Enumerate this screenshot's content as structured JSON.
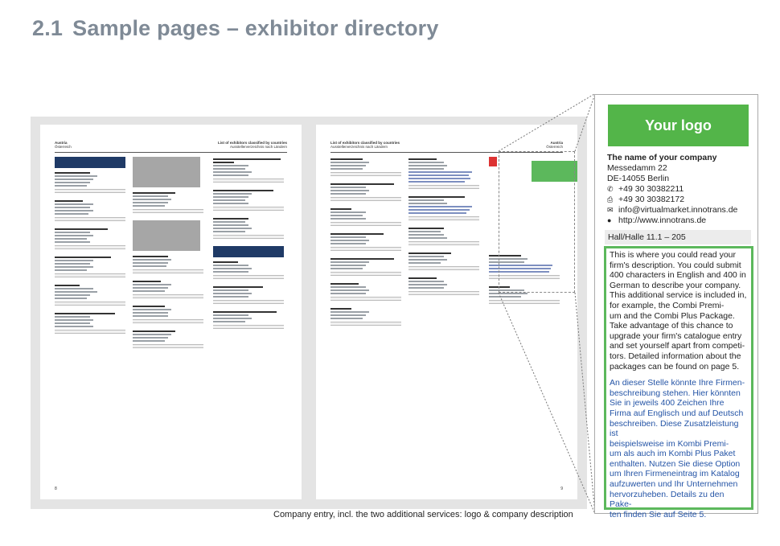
{
  "heading": {
    "number": "2.1",
    "title": "Sample pages – exhibitor directory"
  },
  "spread": {
    "left_page": {
      "title": "Austria",
      "subtitle": "Österreich",
      "right_title": "List of exhibitors classified by countries",
      "right_subtitle": "Ausstellerverzeichnis nach Ländern",
      "page_number": "8"
    },
    "right_page": {
      "title": "List of exhibitors classified by countries",
      "subtitle": "Ausstellerverzeichnis nach Ländern",
      "right_title": "Austria",
      "right_subtitle": "Österreich",
      "page_number": "9"
    }
  },
  "caption": "Company entry, incl. the two additional services: logo & company description",
  "card": {
    "logo_text": "Your logo",
    "company_name": "The name of your company",
    "street": "Messedamm 22",
    "city": "DE-14055 Berlin",
    "phone": "+49 30 30382211",
    "fax": "+49 30 30382172",
    "email": "info@virtualmarket.innotrans.de",
    "web": "http://www.innotrans.de",
    "hall": "Hall/Halle 11.1 – 205",
    "description_en": "This is where you could read your\nfirm's description. You could submit\n400 characters in English and 400 in\nGerman to describe your company.\nThis additional service is included in,\nfor example, the Combi Premi-\num and the Combi Plus Package.\nTake advantage of this chance to\nupgrade your firm's catalogue entry\nand set yourself apart from competi-\ntors. Detailed information about the\npackages can be found on page 5.",
    "description_de": "An dieser Stelle könnte Ihre Firmen-\nbeschreibung stehen. Hier könnten\nSie in jeweils 400 Zeichen Ihre\nFirma auf Englisch und auf Deutsch\nbeschreiben. Diese Zusatzleistung ist\nbeispielsweise im Kombi Premi-\num als auch im Kombi Plus Paket\nenthalten. Nutzen Sie diese Option\num Ihren Firmeneintrag im Katalog\naufzuwerten und Ihr Unternehmen\nhervorzuheben. Details zu den Pake-\nten finden Sie auf Seite 5.",
    "colors": {
      "logo_green": "#53b549",
      "frame_green": "#5cb85c",
      "german_text": "#2454a6",
      "directory_header_blue": "#1f3a66"
    },
    "icons": [
      "phone-icon",
      "fax-icon",
      "email-icon",
      "globe-icon"
    ]
  }
}
